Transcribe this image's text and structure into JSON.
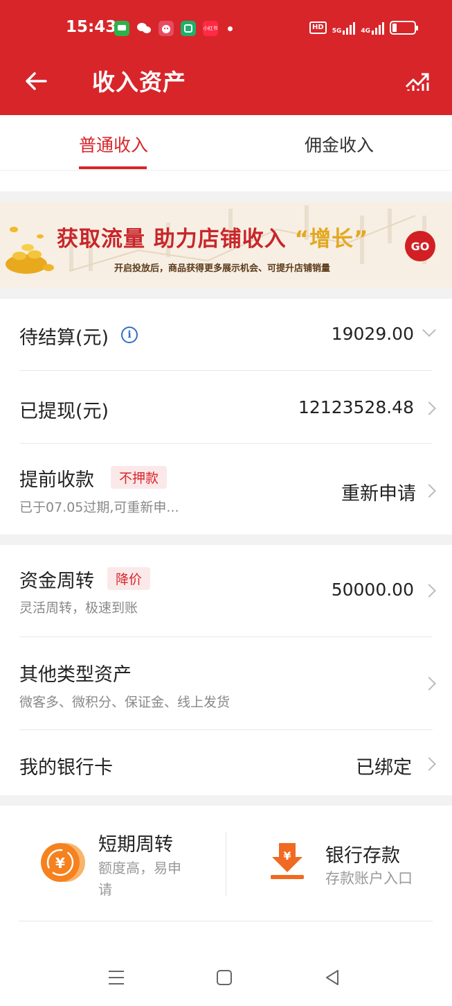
{
  "status": {
    "time": "15:43",
    "apps": [
      {
        "name": "message-app-icon",
        "color": "#2fb14a",
        "label": ""
      },
      {
        "name": "wechat-icon",
        "color": "#d8252a",
        "label": ""
      },
      {
        "name": "mascot-app-icon",
        "color": "#e84a5f",
        "label": ""
      },
      {
        "name": "green-app-icon",
        "color": "#1eb06b",
        "label": ""
      },
      {
        "name": "xiaohongshu-icon",
        "color": "#ff2a44",
        "label": "小红书"
      }
    ],
    "hd": "HD",
    "net1": "5G",
    "net2": "4G"
  },
  "header": {
    "title": "收入资产",
    "back_icon": "arrow-left-icon",
    "trend_icon": "trend-chart-icon"
  },
  "tabs": [
    {
      "label": "普通收入",
      "active": true
    },
    {
      "label": "佣金收入",
      "active": false
    }
  ],
  "banner": {
    "title_main": "获取流量 助力店铺收入",
    "title_quote": "“增长”",
    "subtitle": "开启投放后，商品获得更多展示机会、可提升店铺销量",
    "go": "GO"
  },
  "rows": {
    "pending": {
      "label": "待结算(元)",
      "value": "19029.00"
    },
    "withdrawn": {
      "label": "已提现(元)",
      "value": "12123528.48"
    },
    "advance": {
      "label": "提前收款",
      "tag": "不押款",
      "sub": "已于07.05过期,可重新申...",
      "action": "重新申请"
    },
    "turnover": {
      "label": "资金周转",
      "tag": "降价",
      "sub": "灵活周转，极速到账",
      "value": "50000.00"
    },
    "other": {
      "label": "其他类型资产",
      "sub": "微客多、微积分、保证金、线上发货"
    },
    "bank": {
      "label": "我的银行卡",
      "value": "已绑定"
    }
  },
  "quick": {
    "short": {
      "title": "短期周转",
      "sub1": "额度高，易申",
      "sub2": "请"
    },
    "deposit": {
      "title": "银行存款",
      "sub": "存款账户入口"
    }
  },
  "colors": {
    "brand": "#d8252a",
    "orange": "#f5811f"
  }
}
